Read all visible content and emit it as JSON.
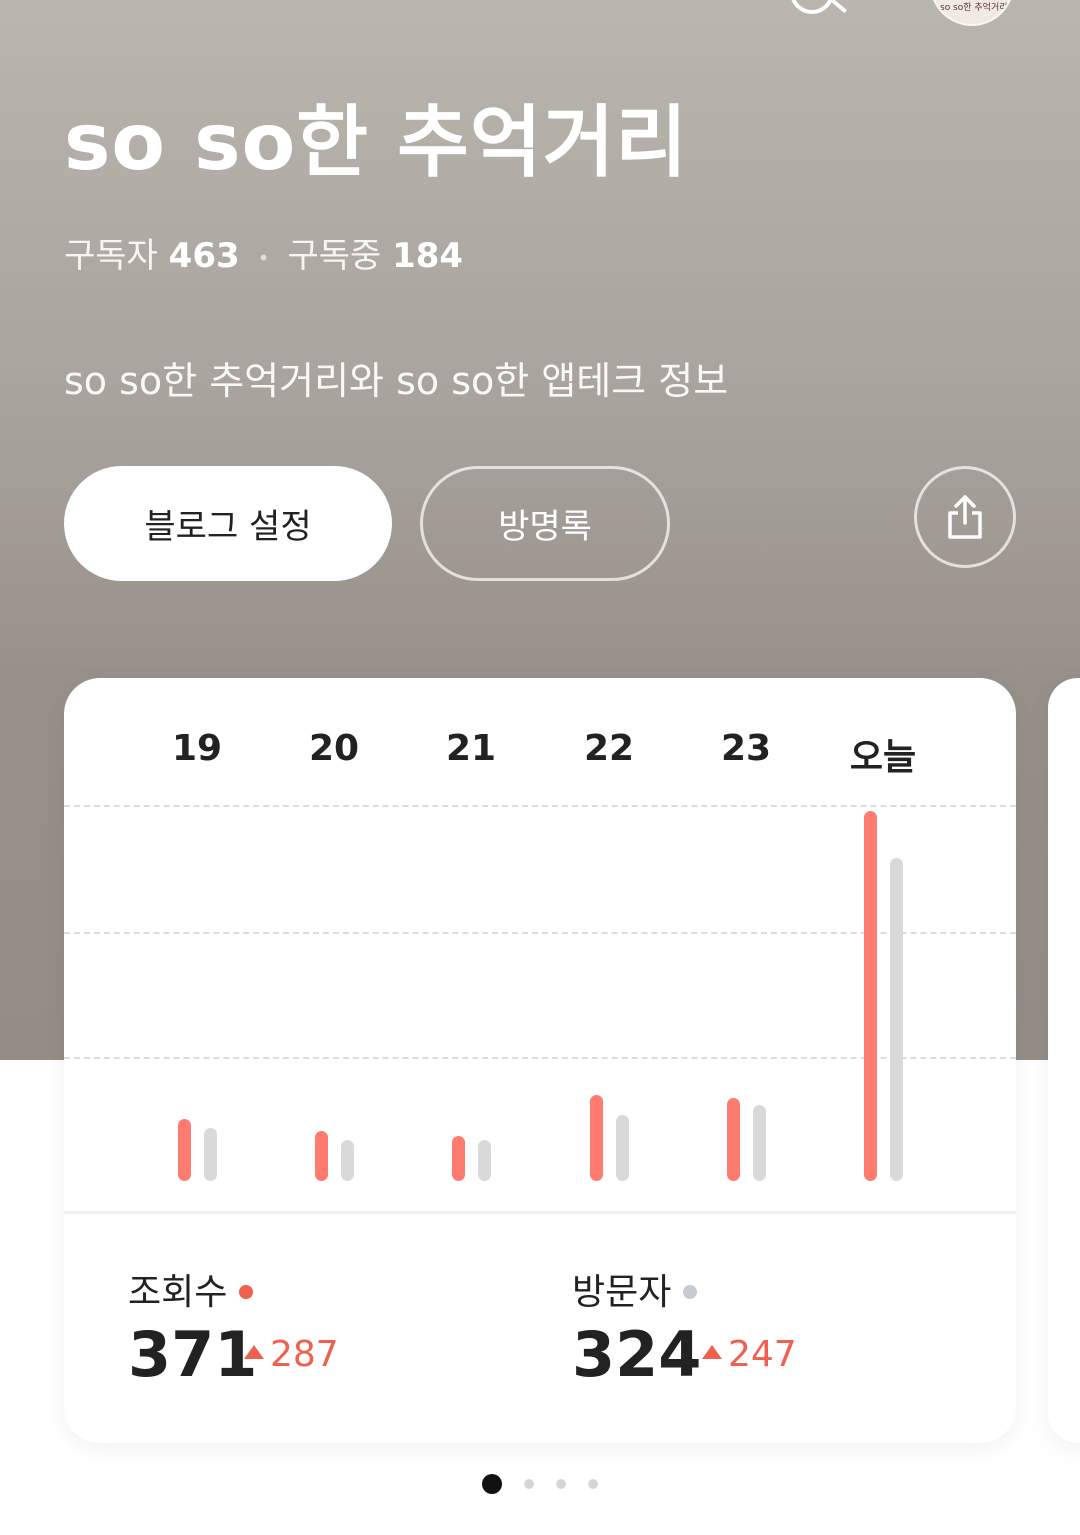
{
  "header": {
    "title": "so so한 추억거리",
    "avatar_text": "so so한 추억거리"
  },
  "stats": {
    "subscribers_label": "구독자",
    "subscribers_value": "463",
    "following_label": "구독중",
    "following_value": "184"
  },
  "description": "so so한 추억거리와  so so한  앱테크 정보",
  "buttons": {
    "settings_label": "블로그 설정",
    "guestbook_label": "방명록"
  },
  "colors": {
    "views": "#ff7b6f",
    "visitors": "#d9d9d9",
    "delta": "#f0604f"
  },
  "chart_data": {
    "type": "bar",
    "categories": [
      "19",
      "20",
      "21",
      "22",
      "23",
      "오늘"
    ],
    "series": [
      {
        "name": "조회수",
        "values": [
          62,
          50,
          45,
          86,
          83,
          371
        ]
      },
      {
        "name": "방문자",
        "values": [
          53,
          41,
          41,
          66,
          76,
          324
        ]
      }
    ],
    "ylim": [
      0,
      375
    ],
    "grid": true
  },
  "summary": {
    "views_label": "조회수",
    "views_value": "371",
    "views_delta": "287",
    "visitors_label": "방문자",
    "visitors_value": "324",
    "visitors_delta": "247"
  },
  "pager": {
    "count": 4,
    "active": 0
  }
}
